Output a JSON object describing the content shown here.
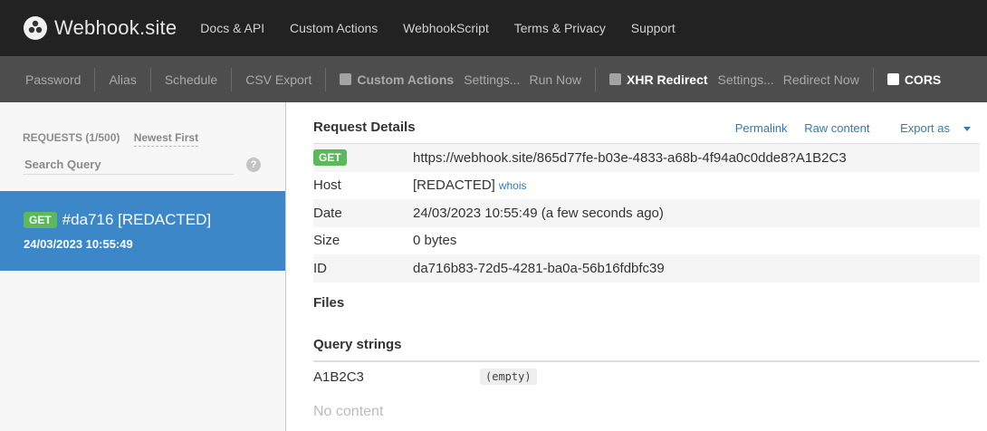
{
  "topbar": {
    "brand": "Webhook.site",
    "nav": [
      "Docs & API",
      "Custom Actions",
      "WebhookScript",
      "Terms & Privacy",
      "Support"
    ]
  },
  "toolbar": {
    "password": "Password",
    "alias": "Alias",
    "schedule": "Schedule",
    "csv_export": "CSV Export",
    "custom_actions": "Custom Actions",
    "custom_settings": "Settings...",
    "run_now": "Run Now",
    "xhr_redirect": "XHR Redirect",
    "xhr_settings": "Settings...",
    "redirect_now": "Redirect Now",
    "cors": "CORS"
  },
  "sidebar": {
    "requests_label": "REQUESTS (1/500)",
    "sort_label": "Newest First",
    "search_placeholder": "Search Query",
    "help": "?",
    "selected_request": {
      "method": "GET",
      "title": "#da716 [REDACTED]",
      "timestamp": "24/03/2023 10:55:49"
    }
  },
  "main": {
    "title": "Request Details",
    "actions": {
      "permalink": "Permalink",
      "raw": "Raw content",
      "export": "Export as"
    },
    "method": "GET",
    "url": "https://webhook.site/865d77fe-b03e-4833-a68b-4f94a0c0dde8?A1B2C3",
    "host_label": "Host",
    "host_value": "[REDACTED]",
    "whois": "whois",
    "date_label": "Date",
    "date_value": "24/03/2023 10:55:49 (a few seconds ago)",
    "size_label": "Size",
    "size_value": "0 bytes",
    "id_label": "ID",
    "id_value": "da716b83-72d5-4281-ba0a-56b16fdbfc39",
    "files_title": "Files",
    "query_title": "Query strings",
    "query": [
      {
        "key": "A1B2C3",
        "value": "(empty)"
      }
    ],
    "no_content": "No content"
  },
  "colors": {
    "topbar": "#222222",
    "toolbar": "#4d4d4d",
    "selected": "#3b87c8",
    "get_badge": "#5cb85c",
    "link": "#337ab7"
  }
}
